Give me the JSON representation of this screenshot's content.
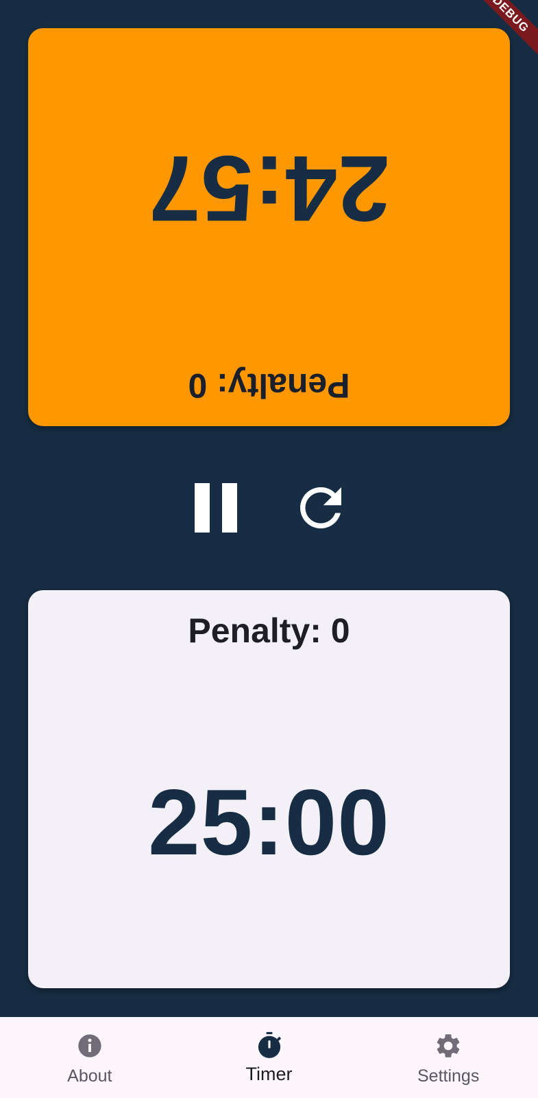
{
  "debug_ribbon": {
    "label": "DEBUG"
  },
  "player_top": {
    "time": "24:57",
    "penalty_label": "Penalty: 0",
    "orientation": "rotated-180",
    "background_color": "#ff9800"
  },
  "player_bottom": {
    "time": "25:00",
    "penalty_label": "Penalty: 0",
    "background_color": "#f4f0f7"
  },
  "controls": {
    "pause_icon": "pause-icon",
    "reset_icon": "reset-icon"
  },
  "bottom_nav": {
    "items": [
      {
        "label": "About",
        "icon": "info-icon",
        "active": false
      },
      {
        "label": "Timer",
        "icon": "timer-icon",
        "active": true
      },
      {
        "label": "Settings",
        "icon": "gear-icon",
        "active": false
      }
    ]
  },
  "colors": {
    "background": "#172d43",
    "accent": "#ff9800",
    "nav_background": "#fdf7fd"
  }
}
